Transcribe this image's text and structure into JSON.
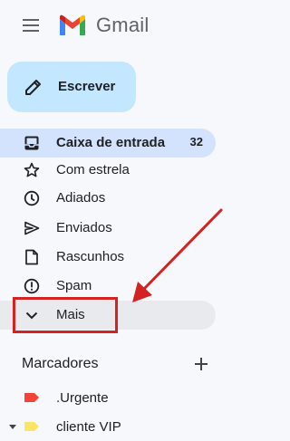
{
  "app": {
    "name": "Gmail"
  },
  "compose": {
    "label": "Escrever"
  },
  "nav": {
    "items": [
      {
        "label": "Caixa de entrada",
        "count": "32",
        "icon": "inbox-icon",
        "active": true
      },
      {
        "label": "Com estrela",
        "icon": "star-icon"
      },
      {
        "label": "Adiados",
        "icon": "clock-icon"
      },
      {
        "label": "Enviados",
        "icon": "send-icon"
      },
      {
        "label": "Rascunhos",
        "icon": "draft-icon"
      },
      {
        "label": "Spam",
        "icon": "spam-icon"
      },
      {
        "label": "Mais",
        "icon": "chevron-down-icon"
      }
    ]
  },
  "labels": {
    "heading": "Marcadores",
    "items": [
      {
        "label": ".Urgente",
        "color": "#f44336"
      },
      {
        "label": "cliente VIP",
        "color": "#fce566"
      }
    ]
  },
  "colors": {
    "compose_bg": "#c2e7ff",
    "active_bg": "#d3e3fd",
    "annotation": "#d42121"
  }
}
